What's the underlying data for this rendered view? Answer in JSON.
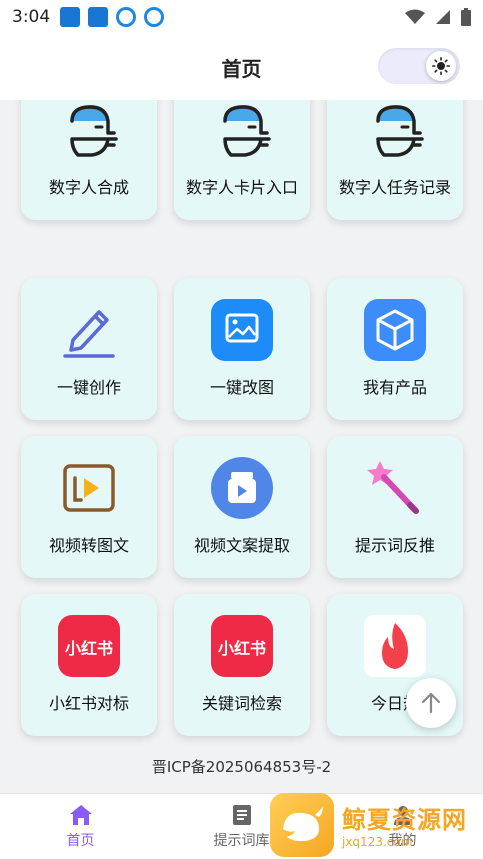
{
  "status_bar": {
    "time": "3:04"
  },
  "header": {
    "title": "首页"
  },
  "cards": [
    {
      "label": "数字人合成",
      "icon": "digital-human-icon"
    },
    {
      "label": "数字人卡片入口",
      "icon": "digital-human-icon"
    },
    {
      "label": "数字人任务记录",
      "icon": "digital-human-icon"
    },
    {
      "label": "一键创作",
      "icon": "pencil-icon"
    },
    {
      "label": "一键改图",
      "icon": "image-edit-icon"
    },
    {
      "label": "我有产品",
      "icon": "box-icon"
    },
    {
      "label": "视频转图文",
      "icon": "video-play-icon"
    },
    {
      "label": "视频文案提取",
      "icon": "video-text-icon"
    },
    {
      "label": "提示词反推",
      "icon": "magic-wand-icon"
    },
    {
      "label": "小红书对标",
      "icon": "xiaohongshu-icon"
    },
    {
      "label": "关键词检索",
      "icon": "xiaohongshu-icon"
    },
    {
      "label": "今日热",
      "icon": "fire-icon"
    }
  ],
  "brand": {
    "xiaohongshu_text": "小红书"
  },
  "footer": {
    "icp": "晋ICP备2025064853号-2"
  },
  "tabbar": {
    "tabs": [
      {
        "label": "首页",
        "icon": "home-icon",
        "active": true
      },
      {
        "label": "提示词库",
        "icon": "document-icon",
        "active": false
      },
      {
        "label": "我的",
        "icon": "profile-icon",
        "active": false
      }
    ]
  },
  "watermark": {
    "name": "鲸夏资源网",
    "url": "jxq123.com"
  },
  "colors": {
    "card_bg": "#e3f8f7",
    "accent": "#8a5cf6",
    "brand_red": "#ee2a46",
    "icon_blue": "#2f8cff"
  }
}
